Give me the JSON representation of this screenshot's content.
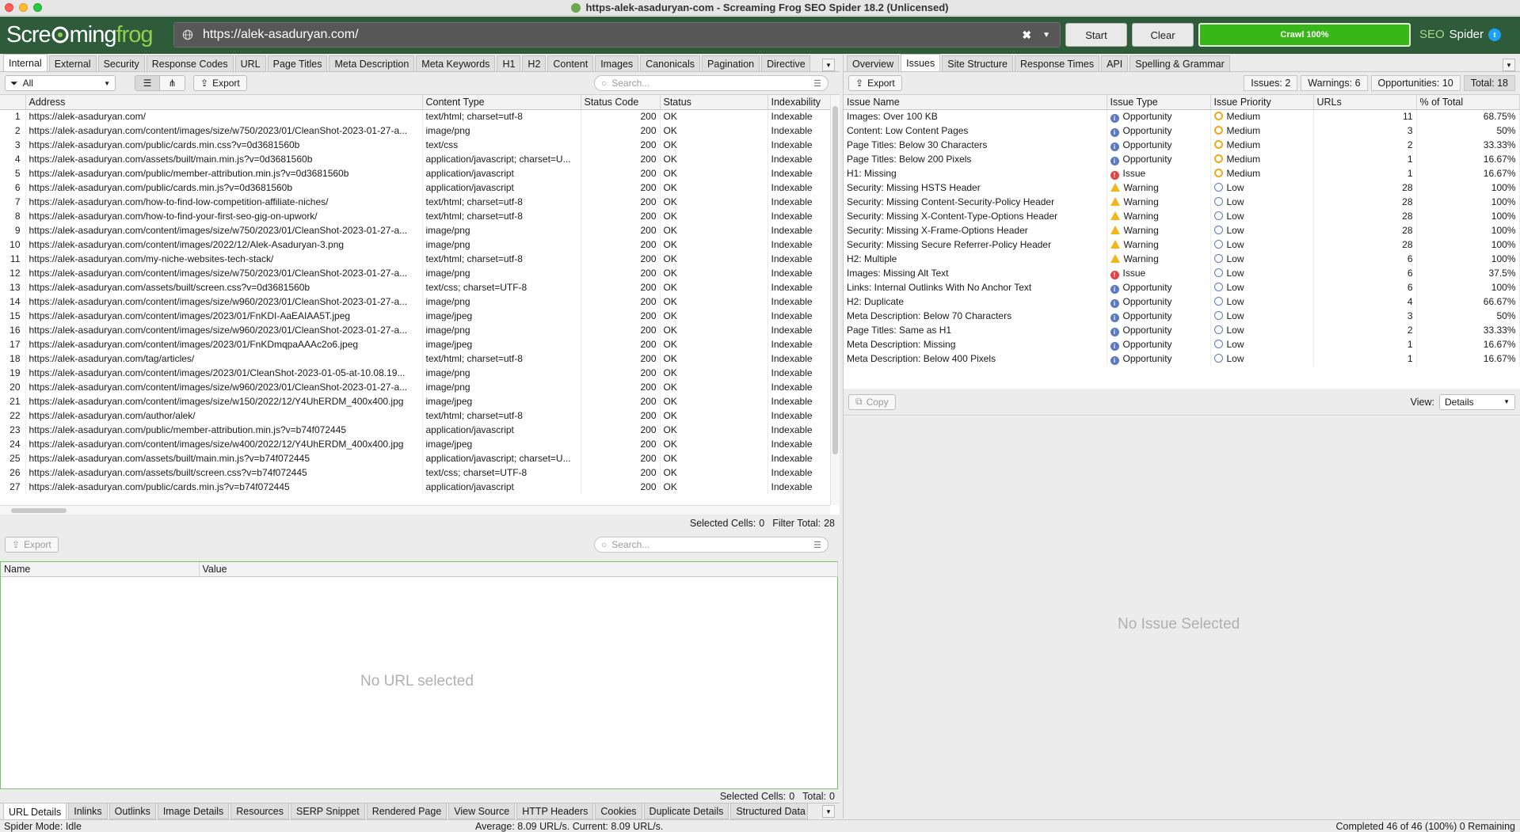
{
  "window": {
    "title": "https-alek-asaduryan-com - Screaming Frog SEO Spider 18.2 (Unlicensed)"
  },
  "toolbar": {
    "logo_text_a": "Scre",
    "logo_text_b": "ming",
    "logo_text_c": "frog",
    "url": "https://alek-asaduryan.com/",
    "start_label": "Start",
    "clear_label": "Clear",
    "progress_label": "Crawl 100%",
    "progress_value": 100,
    "brand_seo": "SEO",
    "brand_spider": "Spider"
  },
  "left": {
    "tabs": [
      "Internal",
      "External",
      "Security",
      "Response Codes",
      "URL",
      "Page Titles",
      "Meta Description",
      "Meta Keywords",
      "H1",
      "H2",
      "Content",
      "Images",
      "Canonicals",
      "Pagination",
      "Directive"
    ],
    "active_tab": "Internal",
    "filter": {
      "value": "All"
    },
    "export_label": "Export",
    "search_placeholder": "Search...",
    "columns": [
      "",
      "Address",
      "Content Type",
      "Status Code",
      "Status",
      "Indexability"
    ],
    "rows": [
      [
        "1",
        "https://alek-asaduryan.com/",
        "text/html; charset=utf-8",
        "200",
        "OK",
        "Indexable"
      ],
      [
        "2",
        "https://alek-asaduryan.com/content/images/size/w750/2023/01/CleanShot-2023-01-27-a...",
        "image/png",
        "200",
        "OK",
        "Indexable"
      ],
      [
        "3",
        "https://alek-asaduryan.com/public/cards.min.css?v=0d3681560b",
        "text/css",
        "200",
        "OK",
        "Indexable"
      ],
      [
        "4",
        "https://alek-asaduryan.com/assets/built/main.min.js?v=0d3681560b",
        "application/javascript; charset=U...",
        "200",
        "OK",
        "Indexable"
      ],
      [
        "5",
        "https://alek-asaduryan.com/public/member-attribution.min.js?v=0d3681560b",
        "application/javascript",
        "200",
        "OK",
        "Indexable"
      ],
      [
        "6",
        "https://alek-asaduryan.com/public/cards.min.js?v=0d3681560b",
        "application/javascript",
        "200",
        "OK",
        "Indexable"
      ],
      [
        "7",
        "https://alek-asaduryan.com/how-to-find-low-competition-affiliate-niches/",
        "text/html; charset=utf-8",
        "200",
        "OK",
        "Indexable"
      ],
      [
        "8",
        "https://alek-asaduryan.com/how-to-find-your-first-seo-gig-on-upwork/",
        "text/html; charset=utf-8",
        "200",
        "OK",
        "Indexable"
      ],
      [
        "9",
        "https://alek-asaduryan.com/content/images/size/w750/2023/01/CleanShot-2023-01-27-a...",
        "image/png",
        "200",
        "OK",
        "Indexable"
      ],
      [
        "10",
        "https://alek-asaduryan.com/content/images/2022/12/Alek-Asaduryan-3.png",
        "image/png",
        "200",
        "OK",
        "Indexable"
      ],
      [
        "11",
        "https://alek-asaduryan.com/my-niche-websites-tech-stack/",
        "text/html; charset=utf-8",
        "200",
        "OK",
        "Indexable"
      ],
      [
        "12",
        "https://alek-asaduryan.com/content/images/size/w750/2023/01/CleanShot-2023-01-27-a...",
        "image/png",
        "200",
        "OK",
        "Indexable"
      ],
      [
        "13",
        "https://alek-asaduryan.com/assets/built/screen.css?v=0d3681560b",
        "text/css; charset=UTF-8",
        "200",
        "OK",
        "Indexable"
      ],
      [
        "14",
        "https://alek-asaduryan.com/content/images/size/w960/2023/01/CleanShot-2023-01-27-a...",
        "image/png",
        "200",
        "OK",
        "Indexable"
      ],
      [
        "15",
        "https://alek-asaduryan.com/content/images/2023/01/FnKDI-AaEAIAA5T.jpeg",
        "image/jpeg",
        "200",
        "OK",
        "Indexable"
      ],
      [
        "16",
        "https://alek-asaduryan.com/content/images/size/w960/2023/01/CleanShot-2023-01-27-a...",
        "image/png",
        "200",
        "OK",
        "Indexable"
      ],
      [
        "17",
        "https://alek-asaduryan.com/content/images/2023/01/FnKDmqpaAAAc2o6.jpeg",
        "image/jpeg",
        "200",
        "OK",
        "Indexable"
      ],
      [
        "18",
        "https://alek-asaduryan.com/tag/articles/",
        "text/html; charset=utf-8",
        "200",
        "OK",
        "Indexable"
      ],
      [
        "19",
        "https://alek-asaduryan.com/content/images/2023/01/CleanShot-2023-01-05-at-10.08.19...",
        "image/png",
        "200",
        "OK",
        "Indexable"
      ],
      [
        "20",
        "https://alek-asaduryan.com/content/images/size/w960/2023/01/CleanShot-2023-01-27-a...",
        "image/png",
        "200",
        "OK",
        "Indexable"
      ],
      [
        "21",
        "https://alek-asaduryan.com/content/images/size/w150/2022/12/Y4UhERDM_400x400.jpg",
        "image/jpeg",
        "200",
        "OK",
        "Indexable"
      ],
      [
        "22",
        "https://alek-asaduryan.com/author/alek/",
        "text/html; charset=utf-8",
        "200",
        "OK",
        "Indexable"
      ],
      [
        "23",
        "https://alek-asaduryan.com/public/member-attribution.min.js?v=b74f072445",
        "application/javascript",
        "200",
        "OK",
        "Indexable"
      ],
      [
        "24",
        "https://alek-asaduryan.com/content/images/size/w400/2022/12/Y4UhERDM_400x400.jpg",
        "image/jpeg",
        "200",
        "OK",
        "Indexable"
      ],
      [
        "25",
        "https://alek-asaduryan.com/assets/built/main.min.js?v=b74f072445",
        "application/javascript; charset=U...",
        "200",
        "OK",
        "Indexable"
      ],
      [
        "26",
        "https://alek-asaduryan.com/assets/built/screen.css?v=b74f072445",
        "text/css; charset=UTF-8",
        "200",
        "OK",
        "Indexable"
      ],
      [
        "27",
        "https://alek-asaduryan.com/public/cards.min.js?v=b74f072445",
        "application/javascript",
        "200",
        "OK",
        "Indexable"
      ]
    ],
    "status": {
      "selected_label": "Selected Cells:",
      "selected_value": "0",
      "filter_label": "Filter Total:",
      "filter_value": "28"
    }
  },
  "lower_left": {
    "export_label": "Export",
    "search_placeholder": "Search...",
    "columns": [
      "Name",
      "Value"
    ],
    "empty_text": "No URL selected",
    "status": {
      "selected_label": "Selected Cells:",
      "selected_value": "0",
      "total_label": "Total:",
      "total_value": "0"
    },
    "tabs": [
      "URL Details",
      "Inlinks",
      "Outlinks",
      "Image Details",
      "Resources",
      "SERP Snippet",
      "Rendered Page",
      "View Source",
      "HTTP Headers",
      "Cookies",
      "Duplicate Details",
      "Structured Data"
    ],
    "active_tab": "URL Details"
  },
  "right": {
    "tabs": [
      "Overview",
      "Issues",
      "Site Structure",
      "Response Times",
      "API",
      "Spelling & Grammar"
    ],
    "active_tab": "Issues",
    "export_label": "Export",
    "summary": {
      "issues": "Issues: 2",
      "warnings": "Warnings: 6",
      "opportunities": "Opportunities: 10",
      "total": "Total: 18"
    },
    "columns": [
      "Issue Name",
      "Issue Type",
      "Issue Priority",
      "URLs",
      "% of Total"
    ],
    "rows": [
      [
        "Images: Over 100 KB",
        "Opportunity",
        "Medium",
        "11",
        "68.75%"
      ],
      [
        "Content: Low Content Pages",
        "Opportunity",
        "Medium",
        "3",
        "50%"
      ],
      [
        "Page Titles: Below 30 Characters",
        "Opportunity",
        "Medium",
        "2",
        "33.33%"
      ],
      [
        "Page Titles: Below 200 Pixels",
        "Opportunity",
        "Medium",
        "1",
        "16.67%"
      ],
      [
        "H1: Missing",
        "Issue",
        "Medium",
        "1",
        "16.67%"
      ],
      [
        "Security: Missing HSTS Header",
        "Warning",
        "Low",
        "28",
        "100%"
      ],
      [
        "Security: Missing Content-Security-Policy Header",
        "Warning",
        "Low",
        "28",
        "100%"
      ],
      [
        "Security: Missing X-Content-Type-Options Header",
        "Warning",
        "Low",
        "28",
        "100%"
      ],
      [
        "Security: Missing X-Frame-Options Header",
        "Warning",
        "Low",
        "28",
        "100%"
      ],
      [
        "Security: Missing Secure Referrer-Policy Header",
        "Warning",
        "Low",
        "28",
        "100%"
      ],
      [
        "H2: Multiple",
        "Warning",
        "Low",
        "6",
        "100%"
      ],
      [
        "Images: Missing Alt Text",
        "Issue",
        "Low",
        "6",
        "37.5%"
      ],
      [
        "Links: Internal Outlinks With No Anchor Text",
        "Opportunity",
        "Low",
        "6",
        "100%"
      ],
      [
        "H2: Duplicate",
        "Opportunity",
        "Low",
        "4",
        "66.67%"
      ],
      [
        "Meta Description: Below 70 Characters",
        "Opportunity",
        "Low",
        "3",
        "50%"
      ],
      [
        "Page Titles: Same as H1",
        "Opportunity",
        "Low",
        "2",
        "33.33%"
      ],
      [
        "Meta Description: Missing",
        "Opportunity",
        "Low",
        "1",
        "16.67%"
      ],
      [
        "Meta Description: Below 400 Pixels",
        "Opportunity",
        "Low",
        "1",
        "16.67%"
      ]
    ],
    "copy_label": "Copy",
    "view_label": "View:",
    "view_value": "Details",
    "empty_text": "No Issue Selected"
  },
  "statusbar": {
    "mode": "Spider Mode: Idle",
    "rate": "Average: 8.09 URL/s. Current: 8.09 URL/s.",
    "completed": "Completed 46 of 46 (100%) 0 Remaining"
  },
  "colors": {
    "toolbar_bg": "#2e5b3a",
    "progress": "#38b818",
    "opportunity": "#5b7bbd",
    "issue": "#e04545",
    "warning": "#f2b61c",
    "medium": "#f0a81c"
  }
}
